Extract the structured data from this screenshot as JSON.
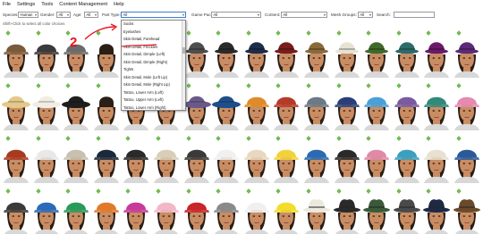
{
  "menu": [
    "File",
    "Settings",
    "Tools",
    "Content Management",
    "Help"
  ],
  "filters": {
    "species": {
      "label": "Species:",
      "value": "Human"
    },
    "gender": {
      "label": "Gender:",
      "value": "All"
    },
    "age": {
      "label": "Age:",
      "value": "All"
    },
    "parttype": {
      "label": "Part Type:",
      "value": "All"
    },
    "gamepack": {
      "label": "Game Pack:",
      "value": "All"
    },
    "content": {
      "label": "Content:",
      "value": "All"
    },
    "meshgroups": {
      "label": "Mesh Groups:",
      "value": "All"
    },
    "search": {
      "label": "Search:",
      "value": ""
    }
  },
  "hint": "Shift+Click to select all color choices",
  "parttype_options": [
    "Socks",
    "Eyelashes",
    "Skin Detail, Forehead",
    "Skin Detail, Freckles",
    "Skin Detail, Dimple (Left)",
    "Skin Detail, Dimple (Right)",
    "Tights",
    "Skin Detail, Mole (Left Lip)",
    "Skin Detail, Mole (Right Lip)",
    "Tattoo, Lower Arm (Left)",
    "Tattoo, Upper Arm (Left)",
    "Tattoo, Lower Arm (Right)"
  ],
  "annotation": {
    "number": "2",
    "color": "#e8141b"
  },
  "badge_color": "#62b33c",
  "rows": [
    {
      "hats": [
        {
          "type": "cap",
          "color": "#7a5a3c",
          "skin": "#c98d64"
        },
        {
          "type": "cap",
          "color": "#3a3a3a",
          "skin": "#c98d64"
        },
        {
          "type": "cap",
          "color": "#6b6b6b",
          "skin": "#c98d64"
        },
        {
          "type": "none",
          "color": "#ffffff",
          "skin": "#c98d64"
        },
        {
          "type": "none",
          "color": "#ffffff",
          "skin": "#c98d64"
        },
        {
          "type": "none",
          "color": "#ffffff",
          "skin": "#c98d64"
        },
        {
          "type": "bowler",
          "color": "#4e4e4e",
          "skin": "#c98d64"
        },
        {
          "type": "bowler",
          "color": "#2a2a2a",
          "skin": "#c98d64"
        },
        {
          "type": "bowler",
          "color": "#1e2c4a",
          "skin": "#c98d64"
        },
        {
          "type": "bowler",
          "color": "#7a1c1c",
          "skin": "#c98d64"
        },
        {
          "type": "bowler",
          "color": "#8a6a3a",
          "skin": "#c98d64"
        },
        {
          "type": "bowler",
          "color": "#e6e2d4",
          "skin": "#c98d64"
        },
        {
          "type": "bowler",
          "color": "#3f6a2a",
          "skin": "#c98d64"
        },
        {
          "type": "bowler",
          "color": "#2b6b6b",
          "skin": "#c98d64"
        },
        {
          "type": "bowler",
          "color": "#6a1a6a",
          "skin": "#c98d64"
        },
        {
          "type": "bowler",
          "color": "#5c2a78",
          "skin": "#c98d64"
        }
      ]
    },
    {
      "hats": [
        {
          "type": "wide",
          "color": "#e3c98a",
          "skin": "#c98d64"
        },
        {
          "type": "wide",
          "color": "#f2ede3",
          "skin": "#c98d64"
        },
        {
          "type": "wide",
          "color": "#1e1e1e",
          "skin": "#c98d64"
        },
        {
          "type": "none",
          "color": "#ffffff",
          "skin": "#c98d64"
        },
        {
          "type": "none",
          "color": "#ffffff",
          "skin": "#c98d64"
        },
        {
          "type": "none",
          "color": "#ffffff",
          "skin": "#c98d64"
        },
        {
          "type": "wide",
          "color": "#6a5a8a",
          "skin": "#c98d64"
        },
        {
          "type": "wide",
          "color": "#1f4f8a",
          "skin": "#c98d64"
        },
        {
          "type": "cap",
          "color": "#e08a2a",
          "skin": "#c98d64"
        },
        {
          "type": "cap",
          "color": "#b53a2a",
          "skin": "#c98d64"
        },
        {
          "type": "cap",
          "color": "#6a7a86",
          "skin": "#c98d64"
        },
        {
          "type": "cap",
          "color": "#2a3f7a",
          "skin": "#c98d64"
        },
        {
          "type": "cap",
          "color": "#4aa0d8",
          "skin": "#c98d64"
        },
        {
          "type": "cap",
          "color": "#7a5aa0",
          "skin": "#c98d64"
        },
        {
          "type": "cap",
          "color": "#2f8a7a",
          "skin": "#c98d64"
        },
        {
          "type": "cap",
          "color": "#e58ab0",
          "skin": "#c98d64"
        }
      ]
    },
    {
      "hats": [
        {
          "type": "cap",
          "color": "#a83a1e",
          "skin": "#c98d64"
        },
        {
          "type": "cap",
          "color": "#e8e8e8",
          "skin": "#c98d64"
        },
        {
          "type": "cap",
          "color": "#c8c0b0",
          "skin": "#c98d64"
        },
        {
          "type": "cap",
          "color": "#1a2a3a",
          "skin": "#c98d64"
        },
        {
          "type": "cap",
          "color": "#2a2a2a",
          "skin": "#c98d64"
        },
        {
          "type": "cap",
          "color": "#d8cfb8",
          "skin": "#c98d64"
        },
        {
          "type": "cap",
          "color": "#3a3a3a",
          "skin": "#c98d64"
        },
        {
          "type": "cap",
          "color": "#f0f0f0",
          "skin": "#c98d64"
        },
        {
          "type": "cap",
          "color": "#e8d8c0",
          "skin": "#c98d64"
        },
        {
          "type": "cap",
          "color": "#f2d23a",
          "skin": "#c98d64"
        },
        {
          "type": "cap",
          "color": "#2a6ab0",
          "skin": "#c98d64"
        },
        {
          "type": "cap",
          "color": "#2a2a2a",
          "skin": "#c98d64"
        },
        {
          "type": "cap",
          "color": "#e08aa8",
          "skin": "#c98d64"
        },
        {
          "type": "cap",
          "color": "#3aa0c0",
          "skin": "#c98d64"
        },
        {
          "type": "cap",
          "color": "#e8e0d0",
          "skin": "#c98d64"
        },
        {
          "type": "cap",
          "color": "#2a5a9a",
          "skin": "#c98d64"
        }
      ]
    },
    {
      "hats": [
        {
          "type": "cap",
          "color": "#3a3a3a",
          "skin": "#c98d64"
        },
        {
          "type": "cap",
          "color": "#2a6ab8",
          "skin": "#c98d64"
        },
        {
          "type": "cap",
          "color": "#2a9a5a",
          "skin": "#c98d64"
        },
        {
          "type": "cap",
          "color": "#e07a2a",
          "skin": "#c98d64"
        },
        {
          "type": "cap",
          "color": "#c83a9a",
          "skin": "#c98d64"
        },
        {
          "type": "cap",
          "color": "#f2b8c8",
          "skin": "#c98d64"
        },
        {
          "type": "cap",
          "color": "#c8242a",
          "skin": "#c98d64"
        },
        {
          "type": "cap",
          "color": "#8a8a8a",
          "skin": "#c98d64"
        },
        {
          "type": "cap",
          "color": "#f0f0f0",
          "skin": "#c98d64"
        },
        {
          "type": "cap",
          "color": "#f2de2a",
          "skin": "#c98d64"
        },
        {
          "type": "fedora",
          "color": "#ece8de",
          "skin": "#c98d64"
        },
        {
          "type": "fedora",
          "color": "#2a2a2a",
          "skin": "#c98d64"
        },
        {
          "type": "fedora",
          "color": "#3a5a3a",
          "skin": "#c98d64"
        },
        {
          "type": "fedora",
          "color": "#4a4a4a",
          "skin": "#c98d64"
        },
        {
          "type": "fedora",
          "color": "#1e2a44",
          "skin": "#c98d64"
        },
        {
          "type": "fedora",
          "color": "#6a4a2a",
          "skin": "#c98d64"
        }
      ]
    }
  ]
}
